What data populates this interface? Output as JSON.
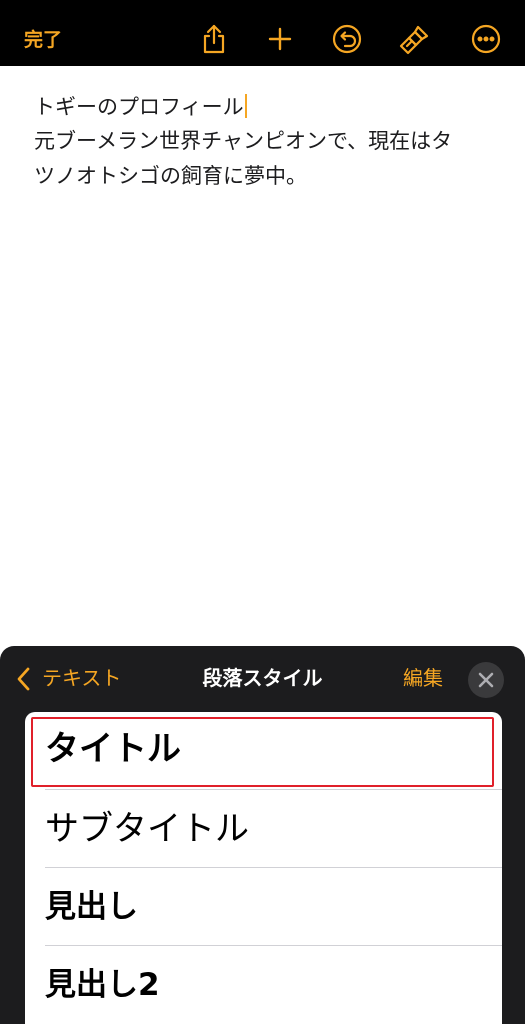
{
  "toolbar": {
    "done_label": "完了",
    "icons": [
      "share-icon",
      "plus-icon",
      "undo-icon",
      "brush-icon",
      "more-icon"
    ],
    "accent_color": "#f5a623"
  },
  "editor": {
    "lines": [
      "トギーのプロフィール",
      "元ブーメラン世界チャンピオンで、現在はタ",
      "ツノオトシゴの飼育に夢中。"
    ]
  },
  "sheet": {
    "back_label": "テキスト",
    "title": "段落スタイル",
    "edit_label": "編集",
    "close_icon": "close-icon"
  },
  "styles": [
    {
      "label": "タイトル",
      "selected": true
    },
    {
      "label": "サブタイトル",
      "selected": false
    },
    {
      "label": "見出し",
      "selected": false
    },
    {
      "label": "見出し2",
      "selected": false
    }
  ],
  "colors": {
    "accent": "#f5a623",
    "highlight_border": "#e0202a",
    "sheet_background": "#1c1c1e"
  }
}
